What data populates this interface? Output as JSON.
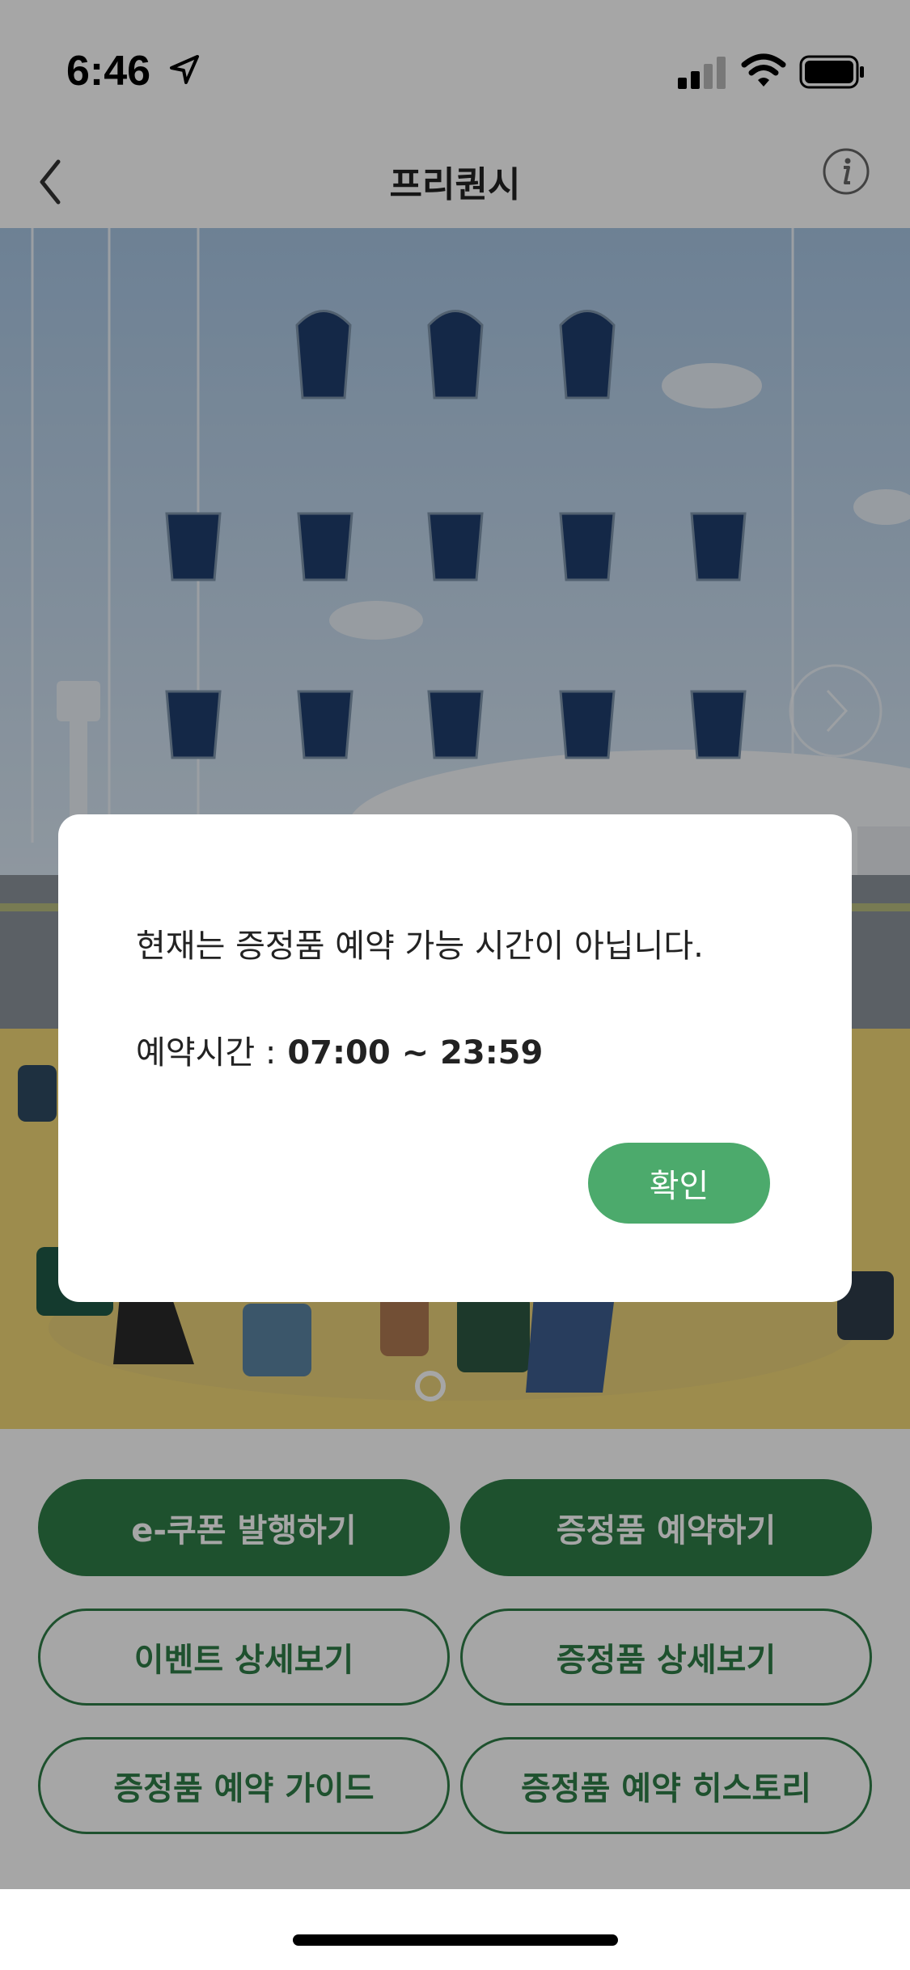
{
  "status_bar": {
    "time": "6:46"
  },
  "nav": {
    "title": "프리퀀시"
  },
  "stamps": {
    "filled": 0,
    "total": 13
  },
  "buttons": {
    "ecoupon": "e-쿠폰 발행하기",
    "reserve_gift": "증정품 예약하기",
    "event_detail": "이벤트 상세보기",
    "gift_detail": "증정품 상세보기",
    "reserve_guide": "증정품 예약 가이드",
    "reserve_history": "증정품 예약 히스토리"
  },
  "modal": {
    "message": "현재는 증정품 예약 가능 시간이 아닙니다.",
    "time_label": "예약시간 :",
    "time_value": " 07:00 ~ 23:59",
    "confirm": "확인"
  },
  "colors": {
    "accent_green": "#2f7d47",
    "confirm_green": "#4caa6c",
    "stamp_navy": "#1f3e6e"
  }
}
